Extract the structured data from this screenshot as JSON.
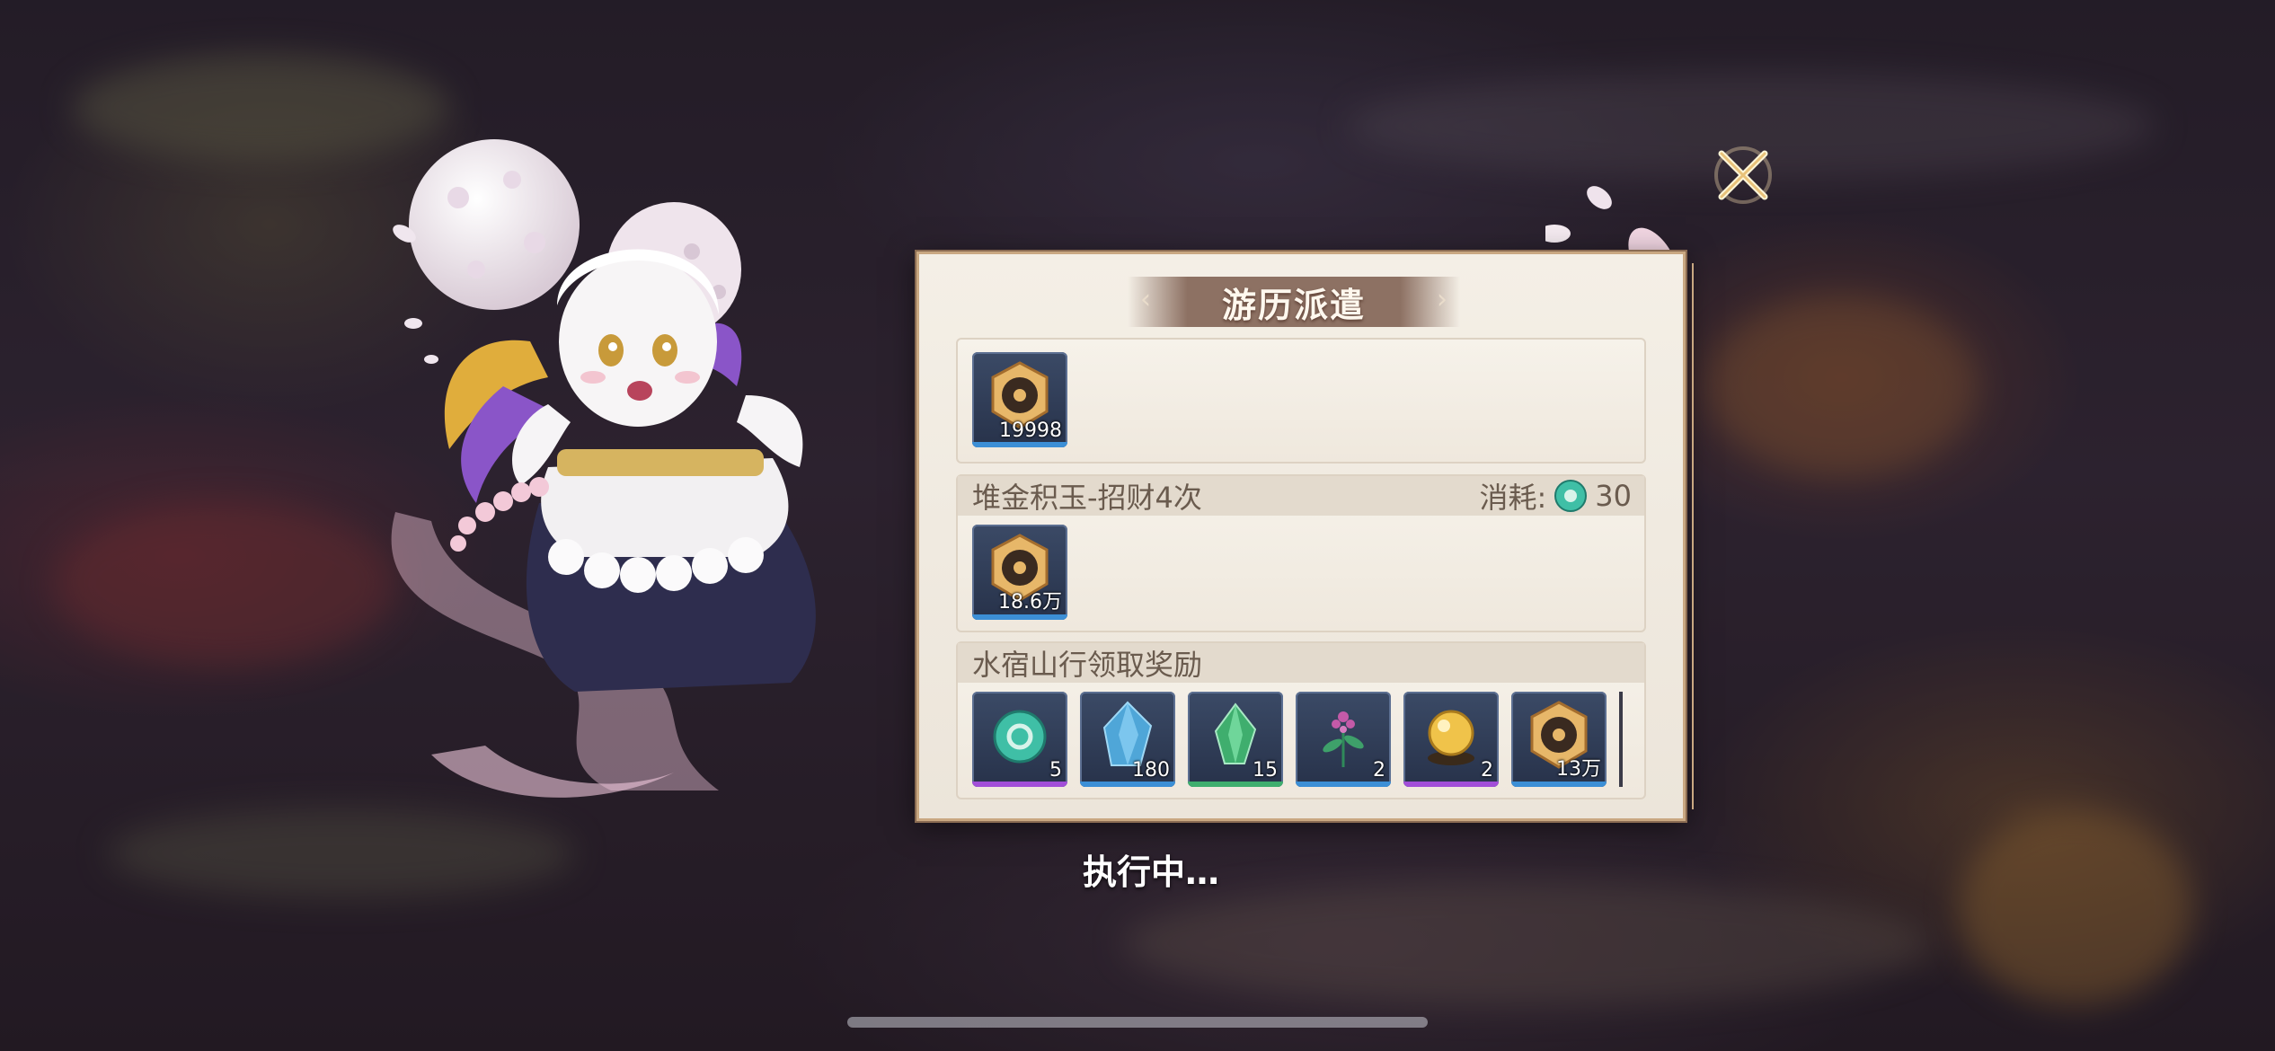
{
  "panel": {
    "title": "游历派遣"
  },
  "sections": [
    {
      "title": "",
      "cost_label": "",
      "cost_value": "",
      "items": [
        {
          "icon": "gold-coin-icon",
          "qty": "19998",
          "rarity": "blue"
        }
      ]
    },
    {
      "title": "堆金积玉-招财4次",
      "cost_label": "消耗:",
      "cost_value": "30",
      "cost_icon": "jade-token-icon",
      "items": [
        {
          "icon": "gold-coin-icon",
          "qty": "18.6万",
          "rarity": "blue"
        }
      ]
    },
    {
      "title": "水宿山行领取奖励",
      "cost_label": "",
      "cost_value": "",
      "items": [
        {
          "icon": "jade-token-icon",
          "qty": "5",
          "rarity": "purple"
        },
        {
          "icon": "blue-crystal-icon",
          "qty": "180",
          "rarity": "blue"
        },
        {
          "icon": "green-crystal-icon",
          "qty": "15",
          "rarity": "green"
        },
        {
          "icon": "herb-plant-icon",
          "qty": "2",
          "rarity": "blue"
        },
        {
          "icon": "golden-orb-icon",
          "qty": "2",
          "rarity": "purple"
        },
        {
          "icon": "gold-coin-icon",
          "qty": "13万",
          "rarity": "blue"
        }
      ]
    }
  ],
  "status_text": "执行中…",
  "colors": {
    "rarity_blue": "#3c8fd6",
    "rarity_purple": "#a24ed8",
    "rarity_green": "#3fae6e",
    "panel_border": "#c9a882",
    "title_bar": "#8d7163"
  }
}
